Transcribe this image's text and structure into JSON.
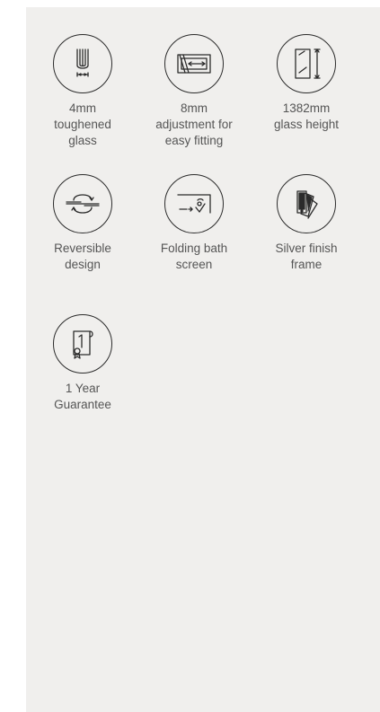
{
  "features": [
    {
      "label": "4mm\ntoughened\nglass",
      "icon": "glass-thickness-icon"
    },
    {
      "label": "8mm\nadjustment for\neasy fitting",
      "icon": "adjustment-icon"
    },
    {
      "label": "1382mm\nglass height",
      "icon": "glass-height-icon"
    },
    {
      "label": "Reversible\ndesign",
      "icon": "reversible-icon"
    },
    {
      "label": "Folding bath\nscreen",
      "icon": "folding-screen-icon"
    },
    {
      "label": "Silver finish\nframe",
      "icon": "finish-swatch-icon"
    },
    {
      "label": "1 Year\nGuarantee",
      "icon": "guarantee-certificate-icon"
    }
  ]
}
